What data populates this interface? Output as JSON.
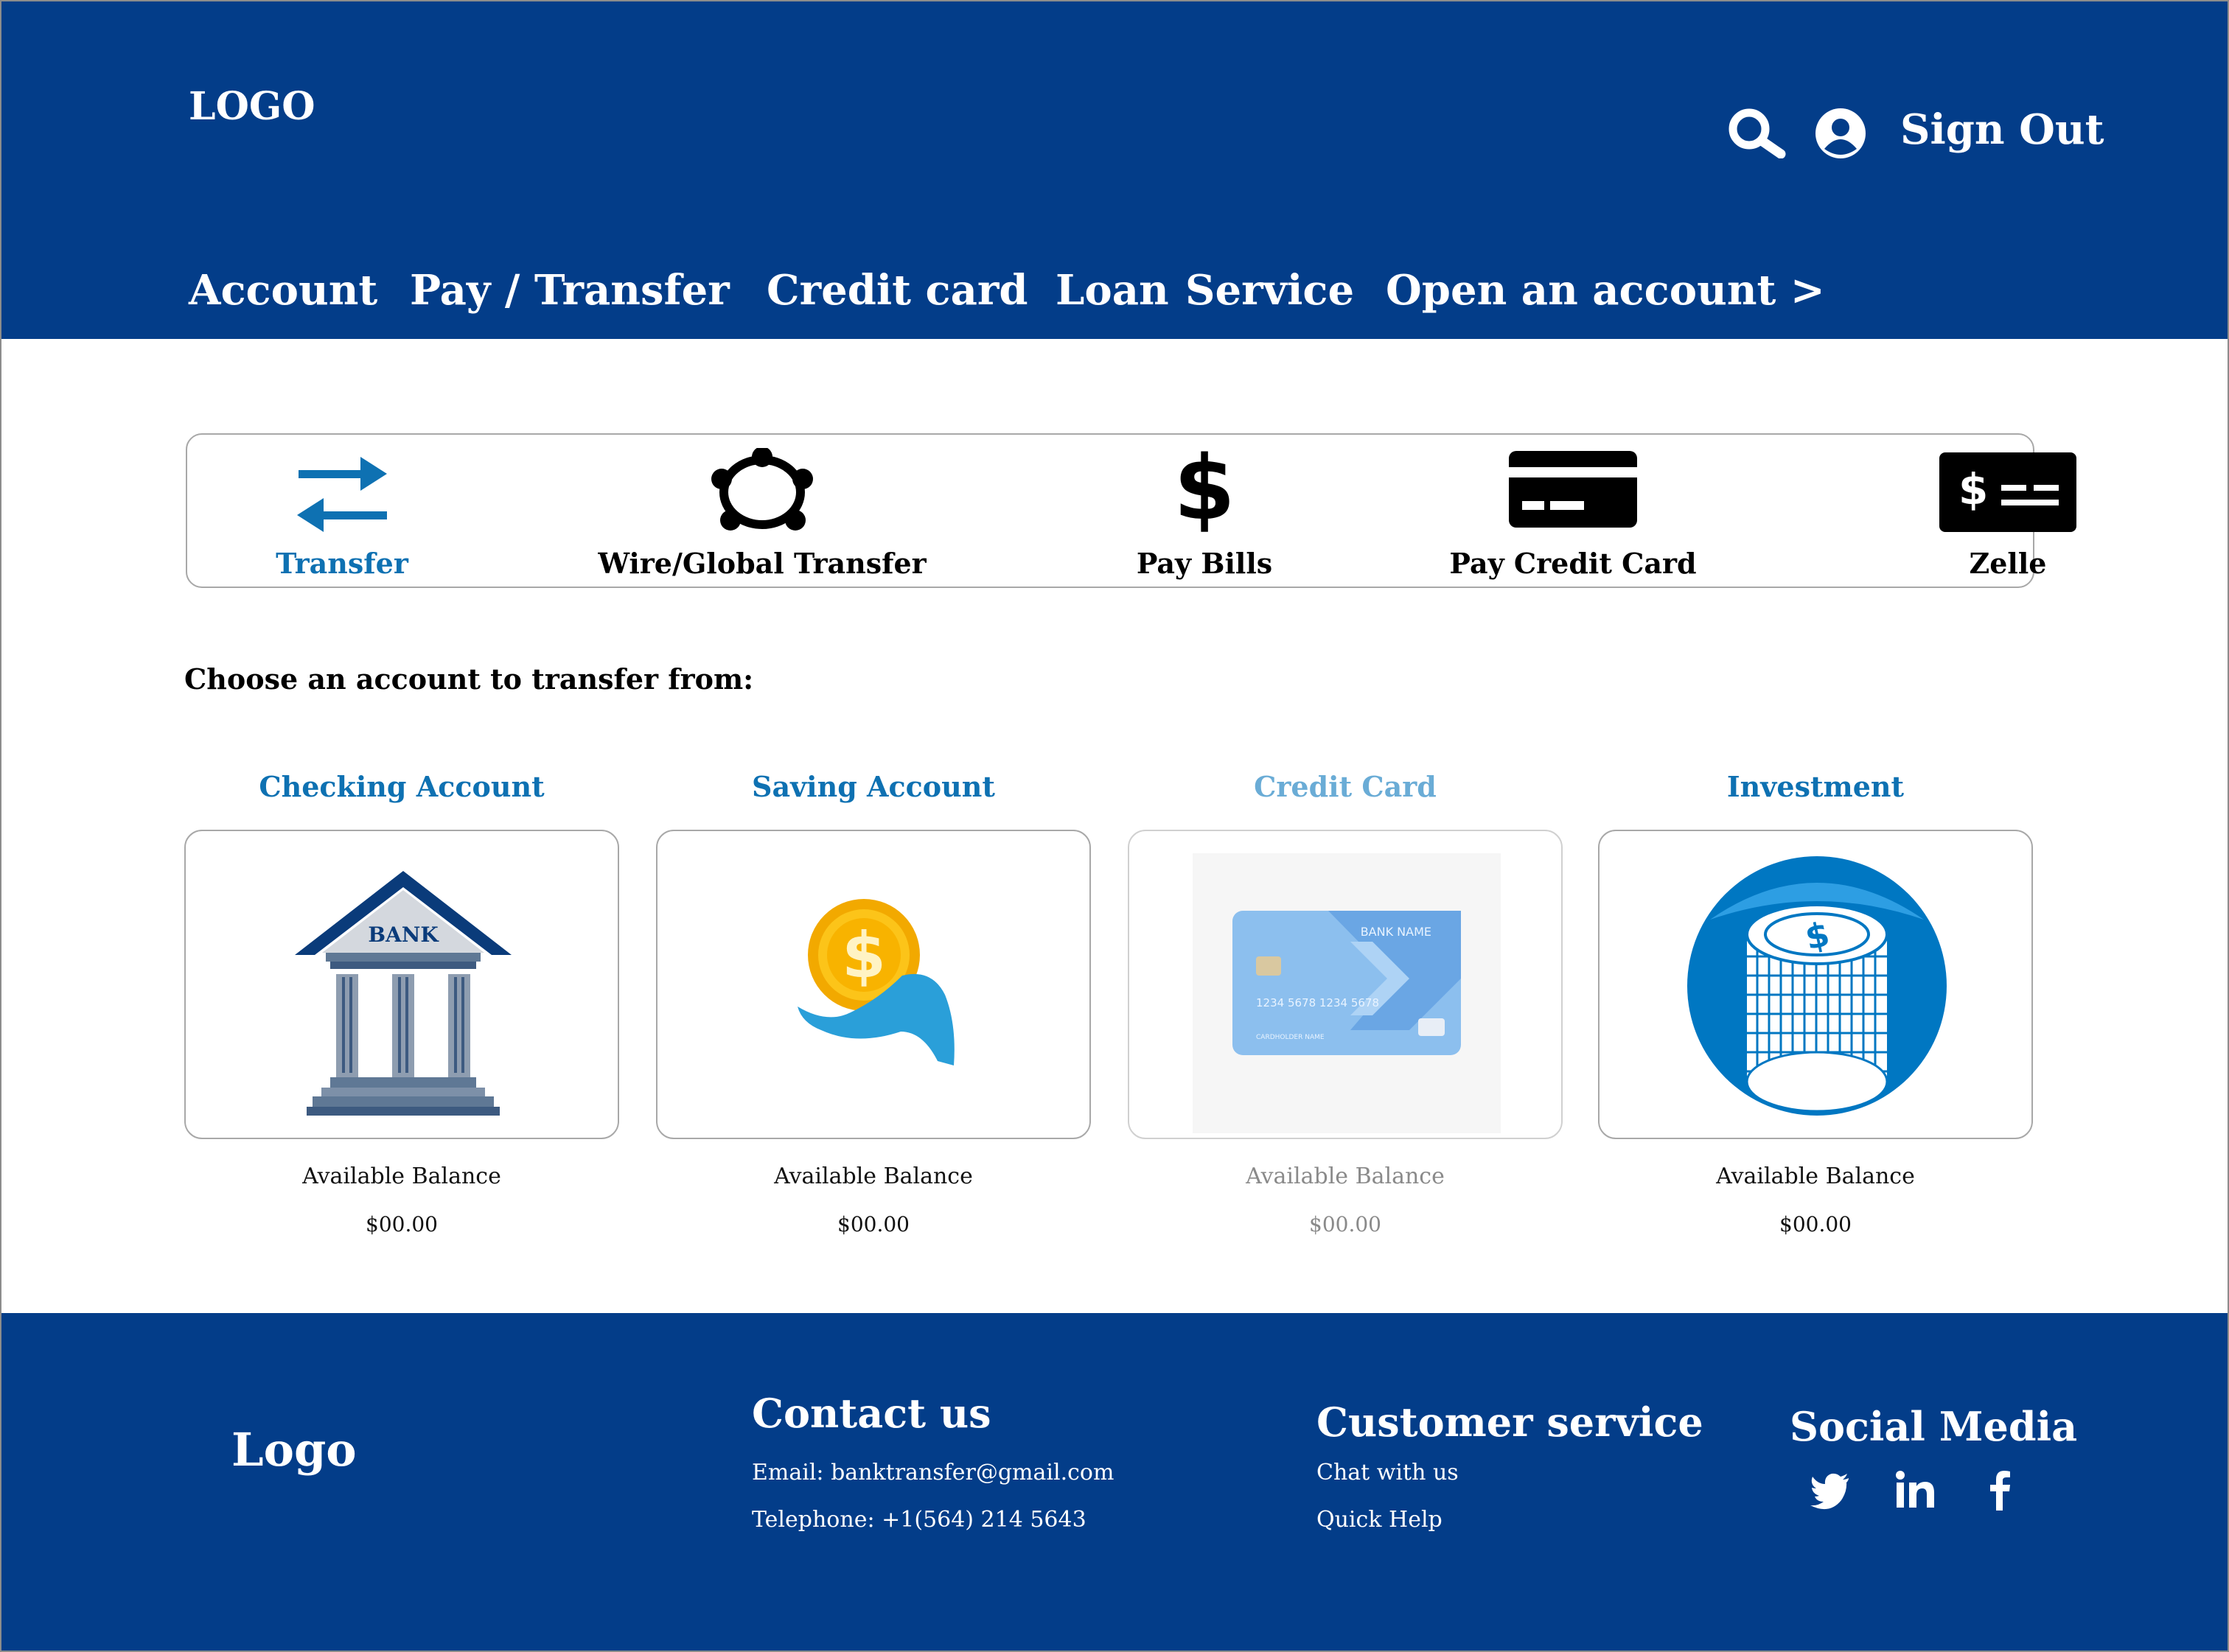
{
  "header": {
    "logo": "LOGO",
    "sign_out": "Sign Out",
    "icons": [
      "search-icon",
      "user-icon"
    ],
    "nav": [
      "Account",
      "Pay / Transfer",
      "Credit card",
      "Loan",
      "Service",
      "Open an account >"
    ]
  },
  "actions": [
    {
      "label": "Transfer",
      "icon": "transfer-arrows-icon",
      "active": true
    },
    {
      "label": "Wire/Global Transfer",
      "icon": "global-network-icon"
    },
    {
      "label": "Pay Bills",
      "icon": "dollar-sign-icon"
    },
    {
      "label": "Pay Credit Card",
      "icon": "credit-card-icon"
    },
    {
      "label": "Zelle",
      "icon": "check-icon"
    }
  ],
  "choose_label": "Choose an account to transfer from:",
  "accounts": [
    {
      "title": "Checking Account",
      "image": "bank-building-icon",
      "image_text": "BANK",
      "balance_label": "Available Balance",
      "balance": "$00.00"
    },
    {
      "title": "Saving Account",
      "image": "coin-in-hand-icon",
      "balance_label": "Available Balance",
      "balance": "$00.00"
    },
    {
      "title": "Credit Card",
      "image": "credit-card-image",
      "image_text": {
        "bank": "BANK NAME",
        "number": "1234   5678   1234   5678",
        "holder": "CARDHOLDER NAME"
      },
      "balance_label": "Available Balance",
      "balance": "$00.00",
      "disabled": true
    },
    {
      "title": "Investment",
      "image": "coin-stack-icon",
      "balance_label": "Available Balance",
      "balance": "$00.00"
    }
  ],
  "footer": {
    "logo": "Logo",
    "contact": {
      "heading": "Contact us",
      "email": "Email: banktransfer@gmail.com",
      "phone": "Telephone: +1(564) 214 5643"
    },
    "service": {
      "heading": "Customer service",
      "links": [
        "Chat with us",
        "Quick Help"
      ]
    },
    "social": {
      "heading": "Social Media",
      "icons": [
        "twitter-icon",
        "linkedin-icon",
        "facebook-icon"
      ]
    }
  },
  "colors": {
    "brand_blue": "#033d89",
    "accent_blue": "#0e71b2",
    "dim_blue": "#6aacd6"
  }
}
